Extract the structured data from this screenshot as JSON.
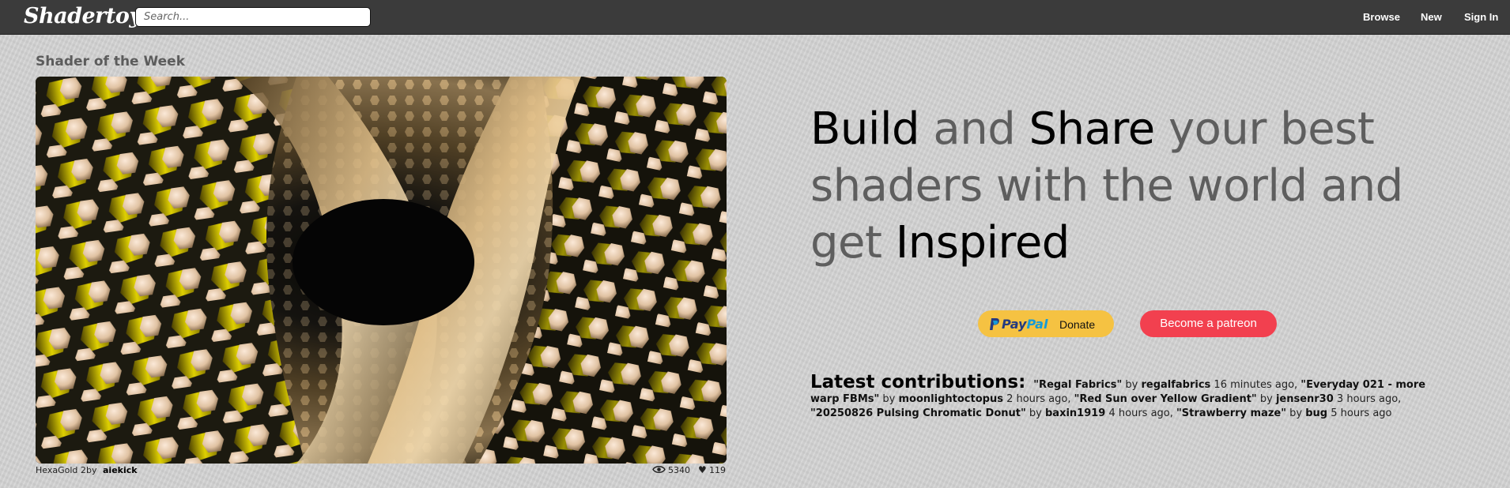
{
  "header": {
    "logo": "Shadertoy",
    "search_placeholder": "Search...",
    "nav": {
      "browse": "Browse",
      "new": "New",
      "sign_in": "Sign In"
    }
  },
  "featured": {
    "section_title": "Shader of the Week",
    "shader_name": "HexaGold 2",
    "by_label": "by",
    "author": "aiekick",
    "views": "5340",
    "likes": "119",
    "views_icon": "eye-icon",
    "likes_icon": "heart-icon"
  },
  "headline": {
    "w1": "Build",
    "w2": " and ",
    "w3": "Share",
    "w4": " your best shaders with the world and get ",
    "w5": "Inspired"
  },
  "support": {
    "paypal_pay": "Pay",
    "paypal_pal": "Pal",
    "paypal_donate": "Donate",
    "patreon": "Become a patreon",
    "paypal_color": "#f5c242",
    "patreon_color": "#f2404f"
  },
  "latest": {
    "label": "Latest contributions:",
    "items": [
      {
        "title": "\"Regal Fabrics\"",
        "by": "by",
        "author": "regalfabrics",
        "time": "16 minutes ago,"
      },
      {
        "title": "\"Everyday 021 - more warp FBMs\"",
        "by": "by",
        "author": "moonlightoctopus",
        "time": "2 hours ago,"
      },
      {
        "title": "\"Red Sun over Yellow Gradient\"",
        "by": "by",
        "author": "jensenr30",
        "time": "3 hours ago,"
      },
      {
        "title": "\"20250826 Pulsing Chromatic Donut\"",
        "by": "by",
        "author": "baxin1919",
        "time": "4 hours ago,"
      },
      {
        "title": "\"Strawberry maze\"",
        "by": "by",
        "author": "bug",
        "time": "5 hours ago"
      }
    ]
  },
  "colors": {
    "topbar": "#3b3b3b",
    "accent_gray": "#5e5e5e"
  }
}
